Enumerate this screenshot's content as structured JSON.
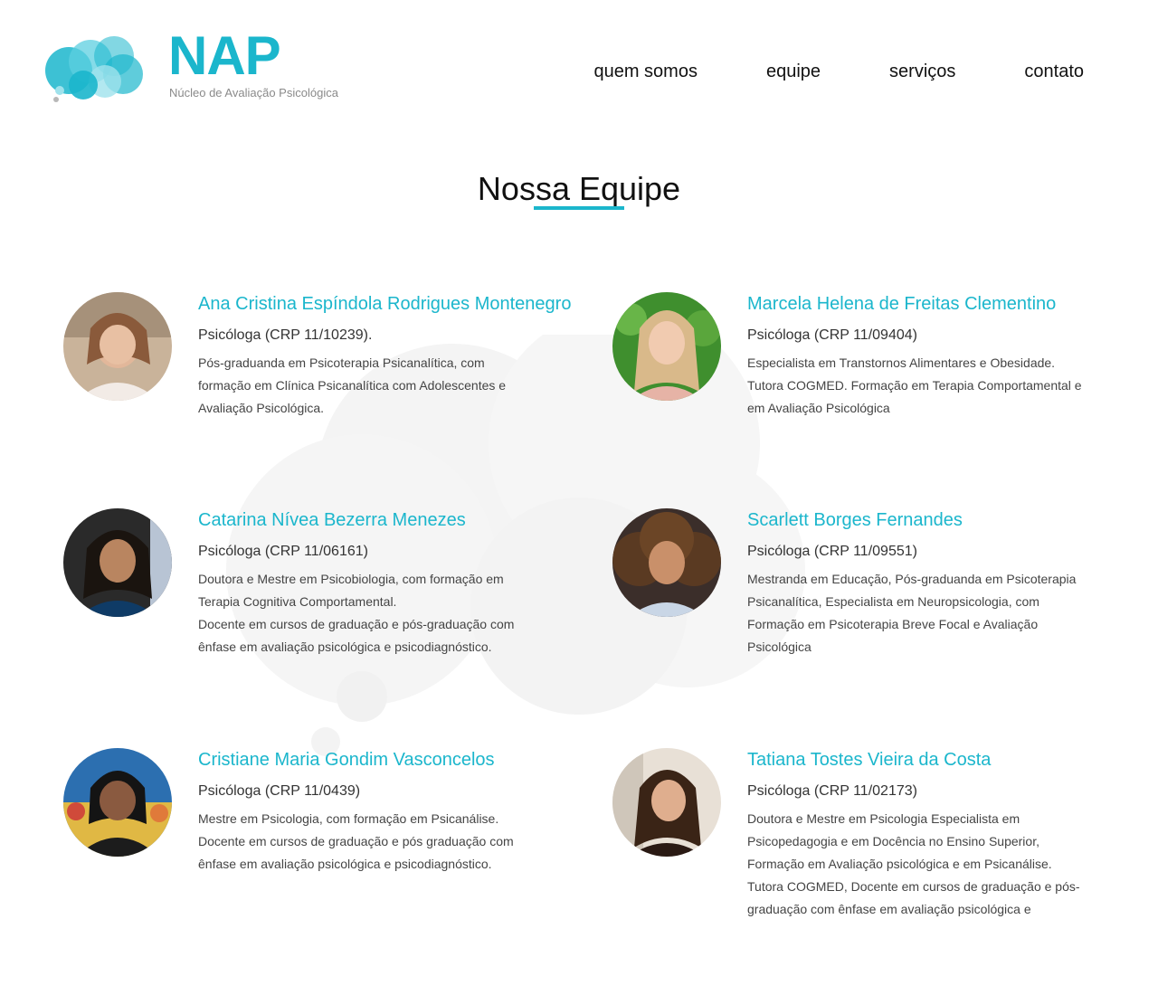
{
  "brand": {
    "name": "NAP",
    "tagline": "Núcleo de Avaliação Psicológica",
    "accent_color": "#1bb6cc"
  },
  "nav": {
    "items": [
      {
        "label": "quem somos"
      },
      {
        "label": "equipe"
      },
      {
        "label": "serviços"
      },
      {
        "label": "contato"
      }
    ]
  },
  "page": {
    "title": "Nossa Equipe"
  },
  "team": [
    {
      "name": "Ana Cristina Espíndola Rodrigues Montenegro",
      "role": "Psicóloga (CRP 11/10239).",
      "bio": "Pós-graduanda em Psicoterapia Psicanalítica, com\nformação em Clínica Psicanalítica com Adolescentes e\nAvaliação Psicológica."
    },
    {
      "name": "Marcela Helena de Freitas Clementino",
      "role": "Psicóloga (CRP 11/09404)",
      "bio": "Especialista em Transtornos Alimentares e Obesidade.\nTutora COGMED. Formação em Terapia Comportamental e\nem Avaliação Psicológica"
    },
    {
      "name": "Catarina Nívea Bezerra Menezes",
      "role": "Psicóloga (CRP 11/06161)",
      "bio": "Doutora e Mestre em Psicobiologia, com formação em\nTerapia Cognitiva Comportamental.\nDocente em cursos de graduação e pós-graduação com\nênfase em avaliação psicológica e psicodiagnóstico."
    },
    {
      "name": "Scarlett Borges Fernandes",
      "role": "Psicóloga (CRP 11/09551)",
      "bio": "Mestranda em Educação, Pós-graduanda em Psicoterapia\nPsicanalítica, Especialista em Neuropsicologia, com\nFormação em Psicoterapia Breve Focal e Avaliação\nPsicológica"
    },
    {
      "name": "Cristiane Maria Gondim Vasconcelos",
      "role": "Psicóloga (CRP 11/0439)",
      "bio": "Mestre em Psicologia, com formação em Psicanálise.\nDocente em cursos de graduação e pós graduação com\nênfase em avaliação psicológica e psicodiagnóstico."
    },
    {
      "name": "Tatiana Tostes Vieira da Costa",
      "role": "Psicóloga (CRP 11/02173)",
      "bio": "Doutora e Mestre em Psicologia Especialista em\nPsicopedagogia e em Docência no Ensino Superior,\nFormação em Avaliação psicológica e em Psicanálise.\nTutora COGMED, Docente em cursos de graduação e pós-\ngraduação com ênfase em avaliação psicológica e"
    }
  ]
}
